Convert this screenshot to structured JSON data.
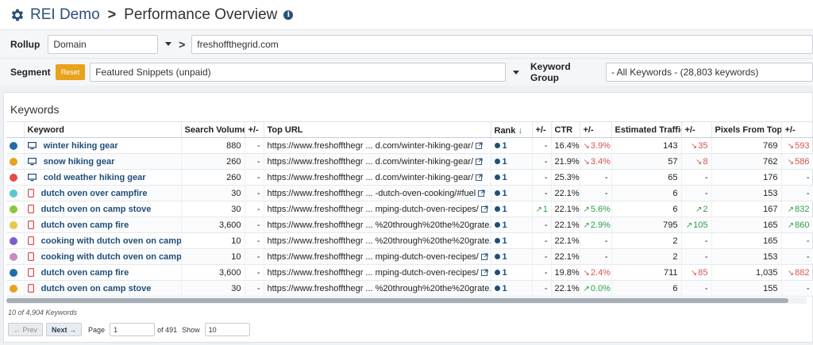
{
  "header": {
    "brand": "REI Demo",
    "title": "Performance Overview"
  },
  "filters": {
    "rollup_label": "Rollup",
    "rollup_value": "Domain",
    "domain_value": "freshoffthegrid.com",
    "segment_label": "Segment",
    "reset_label": "Reset",
    "segment_value": "Featured Snippets (unpaid)",
    "keyword_group_label": "Keyword Group",
    "keyword_group_value": "- All Keywords - (28,803 keywords)"
  },
  "panel": {
    "title": "Keywords"
  },
  "columns": [
    "Keyword",
    "Search Volume",
    "+/-",
    "Top URL",
    "Rank",
    "+/-",
    "CTR",
    "+/-",
    "Estimated Traffic",
    "+/-",
    "Pixels From Top",
    "+/-"
  ],
  "colors": {
    "accent": "#2a4f7a",
    "reset": "#e8a21b",
    "up": "#2e9d4a",
    "down": "#d9534f"
  },
  "rows": [
    {
      "dot": "#1f6ea8",
      "device": "desktop",
      "keyword": "winter hiking gear",
      "volume": "880",
      "vol_chg": "-",
      "url_a": "https://www.freshoffthegr",
      "url_b": "d.com/winter-hiking-gear/",
      "rank": "1",
      "rank_chg": "-",
      "rank_dir": "",
      "ctr": "16.4%",
      "ctr_chg": "3.9%",
      "ctr_dir": "down",
      "traffic": "143",
      "traffic_chg": "35",
      "traffic_dir": "down",
      "pixels": "769",
      "pixels_chg": "593",
      "pixels_dir": "down"
    },
    {
      "dot": "#e8a21b",
      "device": "desktop",
      "keyword": "snow hiking gear",
      "volume": "260",
      "vol_chg": "-",
      "url_a": "https://www.freshoffthegr",
      "url_b": "d.com/winter-hiking-gear/",
      "rank": "1",
      "rank_chg": "-",
      "rank_dir": "",
      "ctr": "21.9%",
      "ctr_chg": "3.4%",
      "ctr_dir": "down",
      "traffic": "57",
      "traffic_chg": "8",
      "traffic_dir": "down",
      "pixels": "762",
      "pixels_chg": "586",
      "pixels_dir": "down"
    },
    {
      "dot": "#e84a4a",
      "device": "desktop",
      "keyword": "cold weather hiking gear",
      "volume": "260",
      "vol_chg": "-",
      "url_a": "https://www.freshoffthegr",
      "url_b": "d.com/winter-hiking-gear/",
      "rank": "1",
      "rank_chg": "-",
      "rank_dir": "",
      "ctr": "25.3%",
      "ctr_chg": "-",
      "ctr_dir": "",
      "traffic": "65",
      "traffic_chg": "-",
      "traffic_dir": "",
      "pixels": "176",
      "pixels_chg": "-",
      "pixels_dir": ""
    },
    {
      "dot": "#5bc8c8",
      "device": "mobile",
      "keyword": "dutch oven over campfire",
      "volume": "30",
      "vol_chg": "-",
      "url_a": "https://www.freshoffthegr",
      "url_b": "-dutch-oven-cooking/#fuel",
      "rank": "1",
      "rank_chg": "-",
      "rank_dir": "",
      "ctr": "22.1%",
      "ctr_chg": "-",
      "ctr_dir": "",
      "traffic": "6",
      "traffic_chg": "-",
      "traffic_dir": "",
      "pixels": "153",
      "pixels_chg": "-",
      "pixels_dir": ""
    },
    {
      "dot": "#8bc53f",
      "device": "mobile",
      "keyword": "dutch oven on camp stove",
      "volume": "30",
      "vol_chg": "-",
      "url_a": "https://www.freshoffthegr",
      "url_b": "mping-dutch-oven-recipes/",
      "rank": "1",
      "rank_chg": "1",
      "rank_dir": "up",
      "ctr": "22.1%",
      "ctr_chg": "5.6%",
      "ctr_dir": "up",
      "traffic": "6",
      "traffic_chg": "2",
      "traffic_dir": "up",
      "pixels": "167",
      "pixels_chg": "832",
      "pixels_dir": "up"
    },
    {
      "dot": "#e8c84a",
      "device": "mobile",
      "keyword": "dutch oven camp fire",
      "volume": "3,600",
      "vol_chg": "-",
      "url_a": "https://www.freshoffthegr",
      "url_b": "%20through%20the%20grate.",
      "rank": "1",
      "rank_chg": "-",
      "rank_dir": "",
      "ctr": "22.1%",
      "ctr_chg": "2.9%",
      "ctr_dir": "up",
      "traffic": "795",
      "traffic_chg": "105",
      "traffic_dir": "up",
      "pixels": "165",
      "pixels_chg": "860",
      "pixels_dir": "up"
    },
    {
      "dot": "#7b5cd6",
      "device": "mobile",
      "keyword": "cooking with dutch oven on campfire",
      "volume": "10",
      "vol_chg": "-",
      "url_a": "https://www.freshoffthegr",
      "url_b": "%20through%20the%20grate.",
      "rank": "1",
      "rank_chg": "-",
      "rank_dir": "",
      "ctr": "22.1%",
      "ctr_chg": "-",
      "ctr_dir": "",
      "traffic": "2",
      "traffic_chg": "-",
      "traffic_dir": "",
      "pixels": "165",
      "pixels_chg": "-",
      "pixels_dir": ""
    },
    {
      "dot": "#c98bc2",
      "device": "mobile",
      "keyword": "cooking with dutch oven on campfire",
      "volume": "10",
      "vol_chg": "-",
      "url_a": "https://www.freshoffthegr",
      "url_b": "mping-dutch-oven-recipes/",
      "rank": "1",
      "rank_chg": "-",
      "rank_dir": "",
      "ctr": "22.1%",
      "ctr_chg": "-",
      "ctr_dir": "",
      "traffic": "2",
      "traffic_chg": "-",
      "traffic_dir": "",
      "pixels": "153",
      "pixels_chg": "-",
      "pixels_dir": ""
    },
    {
      "dot": "#1f6ea8",
      "device": "mobile",
      "keyword": "dutch oven camp fire",
      "volume": "3,600",
      "vol_chg": "-",
      "url_a": "https://www.freshoffthegr",
      "url_b": "mping-dutch-oven-recipes/",
      "rank": "1",
      "rank_chg": "-",
      "rank_dir": "",
      "ctr": "19.8%",
      "ctr_chg": "2.4%",
      "ctr_dir": "down",
      "traffic": "711",
      "traffic_chg": "85",
      "traffic_dir": "down",
      "pixels": "1,035",
      "pixels_chg": "882",
      "pixels_dir": "down"
    },
    {
      "dot": "#e8a21b",
      "device": "mobile",
      "keyword": "dutch oven on camp stove",
      "volume": "30",
      "vol_chg": "-",
      "url_a": "https://www.freshoffthegr",
      "url_b": "%20through%20the%20grate.",
      "rank": "1",
      "rank_chg": "-",
      "rank_dir": "",
      "ctr": "22.1%",
      "ctr_chg": "0.0%",
      "ctr_dir": "up",
      "traffic": "6",
      "traffic_chg": "-",
      "traffic_dir": "",
      "pixels": "155",
      "pixels_chg": "-",
      "pixels_dir": ""
    }
  ],
  "footer": {
    "count_text": "10 of 4,904 Keywords",
    "prev_label": "← Prev",
    "next_label": "Next →",
    "page_label": "Page",
    "page_value": "1",
    "of_pages": "of 491",
    "show_label": "Show",
    "show_value": "10"
  }
}
